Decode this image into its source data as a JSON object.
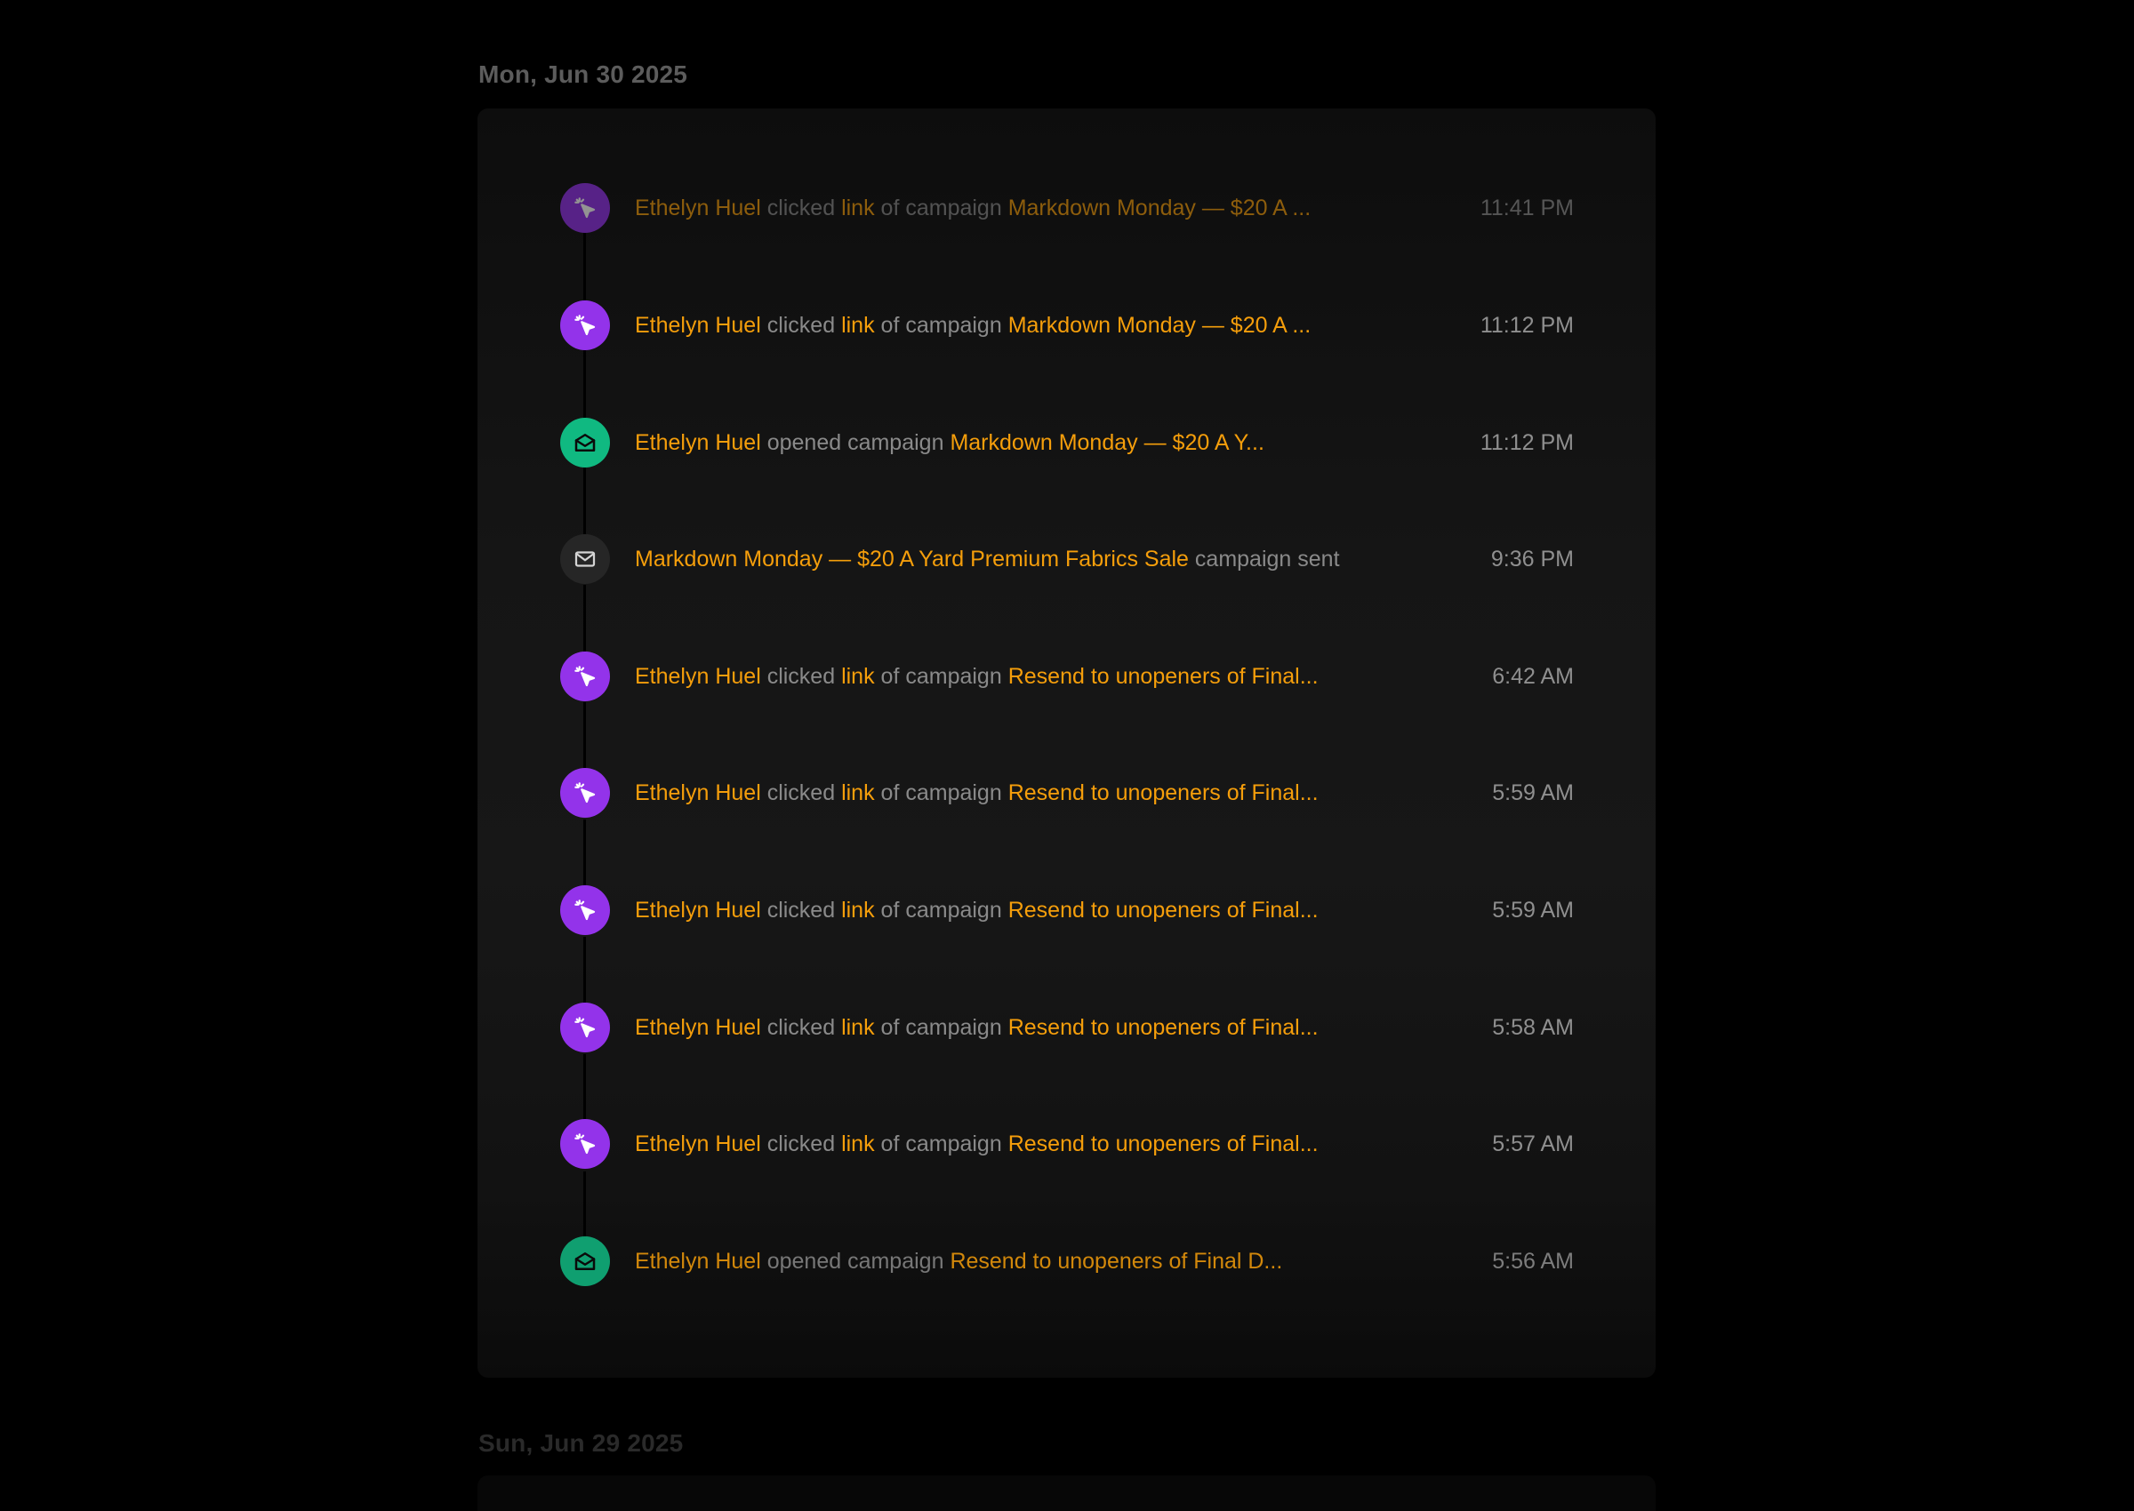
{
  "sections": [
    {
      "date": "Mon, Jun 30 2025",
      "events": [
        {
          "icon": "cursor-click-icon",
          "actor": "Ethelyn Huel",
          "verb": "clicked",
          "link": "link",
          "mid": "of campaign",
          "campaign": "Markdown Monday — $20 A ...",
          "suffix": "",
          "time": "11:41 PM"
        },
        {
          "icon": "cursor-click-icon",
          "actor": "Ethelyn Huel",
          "verb": "clicked",
          "link": "link",
          "mid": "of campaign",
          "campaign": "Markdown Monday — $20 A ...",
          "suffix": "",
          "time": "11:12 PM"
        },
        {
          "icon": "envelope-open-icon",
          "actor": "Ethelyn Huel",
          "verb": "opened campaign",
          "link": "",
          "mid": "",
          "campaign": "Markdown Monday — $20 A Y...",
          "suffix": "",
          "time": "11:12 PM"
        },
        {
          "icon": "envelope-icon",
          "actor": "",
          "verb": "",
          "link": "",
          "mid": "",
          "campaign": "Markdown Monday — $20 A Yard Premium Fabrics Sale",
          "suffix": "campaign sent",
          "time": "9:36 PM"
        },
        {
          "icon": "cursor-click-icon",
          "actor": "Ethelyn Huel",
          "verb": "clicked",
          "link": "link",
          "mid": "of campaign",
          "campaign": "Resend to unopeners of Final...",
          "suffix": "",
          "time": "6:42 AM"
        },
        {
          "icon": "cursor-click-icon",
          "actor": "Ethelyn Huel",
          "verb": "clicked",
          "link": "link",
          "mid": "of campaign",
          "campaign": "Resend to unopeners of Final...",
          "suffix": "",
          "time": "5:59 AM"
        },
        {
          "icon": "cursor-click-icon",
          "actor": "Ethelyn Huel",
          "verb": "clicked",
          "link": "link",
          "mid": "of campaign",
          "campaign": "Resend to unopeners of Final...",
          "suffix": "",
          "time": "5:59 AM"
        },
        {
          "icon": "cursor-click-icon",
          "actor": "Ethelyn Huel",
          "verb": "clicked",
          "link": "link",
          "mid": "of campaign",
          "campaign": "Resend to unopeners of Final...",
          "suffix": "",
          "time": "5:58 AM"
        },
        {
          "icon": "cursor-click-icon",
          "actor": "Ethelyn Huel",
          "verb": "clicked",
          "link": "link",
          "mid": "of campaign",
          "campaign": "Resend to unopeners of Final...",
          "suffix": "",
          "time": "5:57 AM"
        },
        {
          "icon": "envelope-open-icon",
          "actor": "Ethelyn Huel",
          "verb": "opened campaign",
          "link": "",
          "mid": "",
          "campaign": "Resend to unopeners of Final D...",
          "suffix": "",
          "time": "5:56 AM"
        }
      ]
    },
    {
      "date": "Sun, Jun 29 2025",
      "events": []
    }
  ],
  "colors": {
    "accent": "#f59e0b",
    "click_icon_bg": "#9333ea",
    "open_icon_bg": "#10b981",
    "sent_icon_bg": "#262626"
  }
}
